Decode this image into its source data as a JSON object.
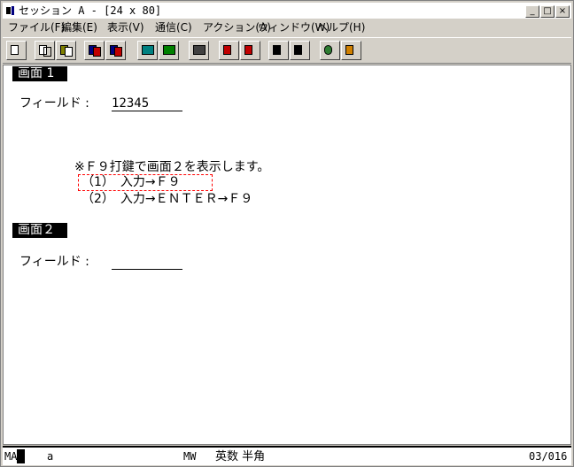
{
  "window": {
    "title": "セッション A - [24 x 80]",
    "buttons": {
      "minimize": "_",
      "maximize": "□",
      "close": "×"
    }
  },
  "menu": {
    "items": [
      "ファイル(F)",
      "編集(E)",
      "表示(V)",
      "通信(C)",
      "アクション(A)",
      "ウィンドウ(W)",
      "ヘルプ(H)"
    ]
  },
  "toolbar": {
    "buttons": [
      "print-screen",
      "copy",
      "paste",
      "send",
      "receive",
      "display-setup",
      "keyboard-setup",
      "macro",
      "record-macro",
      "stop-macro",
      "play-macro",
      "run-macro",
      "transfer",
      "help"
    ]
  },
  "screen": {
    "section1_header": "画面 1",
    "field1_label": "フィールド :",
    "field1_value": "12345",
    "note_line": "※Ｆ９打鍵で画面２を表示します。",
    "step1": "（1）　入力→Ｆ９",
    "step2": "（2）　入力→ＥＮＴＥＲ→Ｆ９",
    "section2_header": "画面２",
    "field2_label": "フィールド :",
    "field2_value": ""
  },
  "status": {
    "mode": "MA",
    "session": "a",
    "mw": "MW",
    "input_mode": "英数 半角",
    "position": "03/016"
  },
  "colors": {
    "highlight_box": "#ff0000",
    "header_bg": "#000000",
    "header_fg": "#ffffff"
  }
}
